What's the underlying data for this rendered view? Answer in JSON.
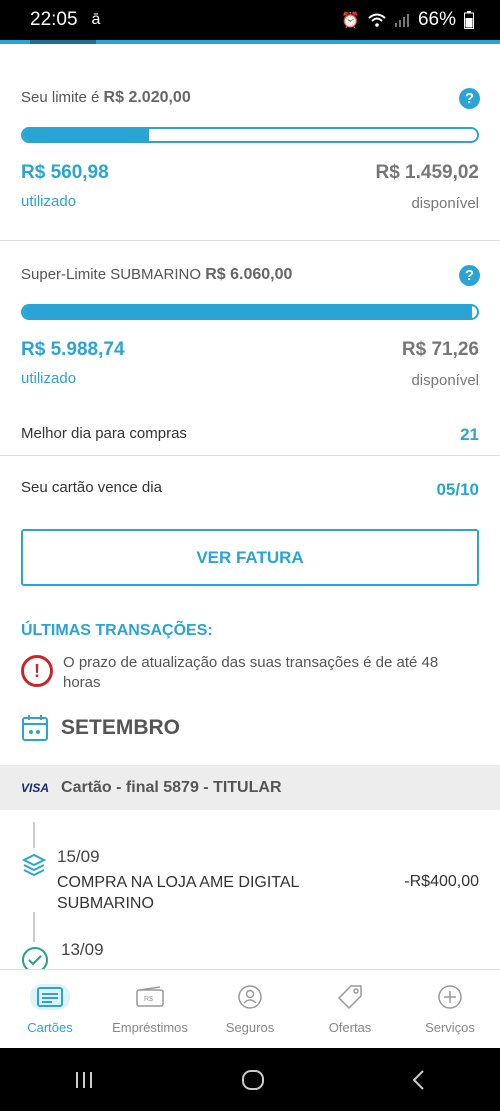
{
  "status": {
    "time": "22:05",
    "battery": "66%"
  },
  "limit": {
    "label": "Seu limite é",
    "total": "R$ 2.020,00",
    "used_amount": "R$ 560,98",
    "used_label": "utilizado",
    "available_amount": "R$ 1.459,02",
    "available_label": "disponível",
    "used_fraction": 0.278
  },
  "super_limit": {
    "label": "Super-Limite SUBMARINO",
    "total": "R$ 6.060,00",
    "used_amount": "R$ 5.988,74",
    "used_label": "utilizado",
    "available_amount": "R$ 71,26",
    "available_label": "disponível",
    "used_fraction": 0.988
  },
  "info": {
    "best_day_label": "Melhor dia para compras",
    "best_day_value": "21",
    "due_label": "Seu cartão vence dia",
    "due_value": "05/10"
  },
  "invoice_button": "VER FATURA",
  "transactions": {
    "title": "ÚLTIMAS TRANSAÇÕES:",
    "warning": "O prazo de atualização das suas transações é de até 48 horas",
    "month": "SETEMBRO",
    "card_brand": "VISA",
    "card_label": "Cartão - final 5879 - TITULAR",
    "items": [
      {
        "date": "15/09",
        "description": "COMPRA NA LOJA AME DIGITAL SUBMARINO",
        "amount": "-R$400,00",
        "icon": "layers-icon"
      },
      {
        "date": "13/09",
        "description": "",
        "amount": "",
        "icon": "check-circle-icon"
      }
    ]
  },
  "nav": [
    {
      "label": "Cartões",
      "icon": "card-icon",
      "active": true
    },
    {
      "label": "Empréstimos",
      "icon": "loan-icon",
      "active": false
    },
    {
      "label": "Seguros",
      "icon": "insurance-icon",
      "active": false
    },
    {
      "label": "Ofertas",
      "icon": "tag-icon",
      "active": false
    },
    {
      "label": "Serviços",
      "icon": "plus-circle-icon",
      "active": false
    }
  ],
  "colors": {
    "accent": "#2aa4d5",
    "warning": "#c62828"
  }
}
